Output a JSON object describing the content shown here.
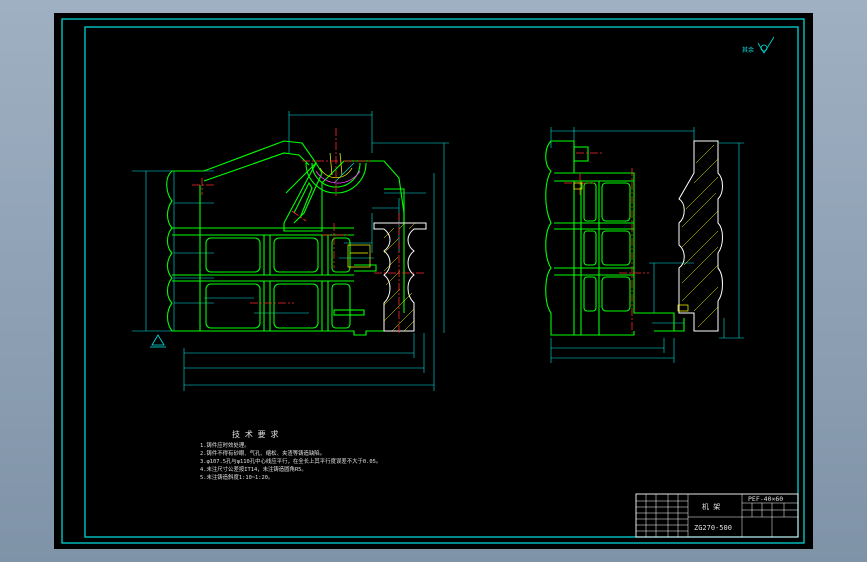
{
  "colors": {
    "background": "#000000",
    "frame": "#00e5e5",
    "outline": "#00ff00",
    "dimension": "#00e5e5",
    "centerline": "#ff2a2a",
    "hatch": "#ffff00",
    "section": "#ffffff",
    "text": "#e0e0e0"
  },
  "roughness_symbol": {
    "text": "其余",
    "value": "Ra"
  },
  "tech_requirements": {
    "title": "技 术 要 求",
    "items": [
      "1.铸件应时效处理。",
      "2.铸件不得有砂眼、气孔、缩松、夹渣等铸造缺陷。",
      "3.φ107.5孔与φ110孔中心线应平行，在全长上其平行度误差不大于0.05。",
      "4.未注尺寸公差按IT14，未注铸造圆角R5。",
      "5.未注铸造斜度1:10~1:20。"
    ]
  },
  "title_block": {
    "part_name": "机 架",
    "model": "PEF-40×60",
    "material": "ZG270-500"
  }
}
